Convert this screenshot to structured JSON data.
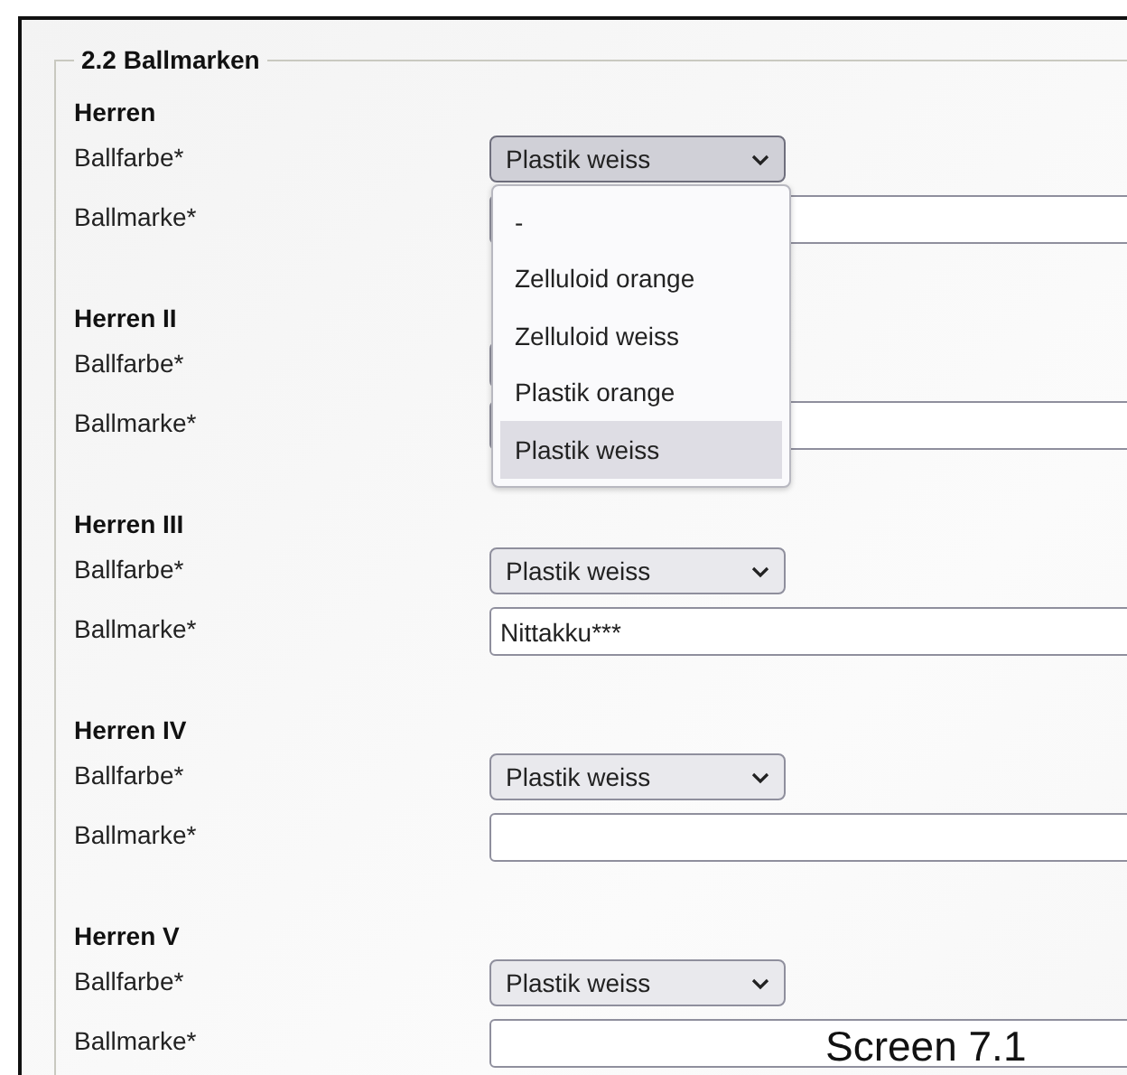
{
  "section": {
    "legend": "2.2 Ballmarken"
  },
  "teams": [
    {
      "name": "Herren",
      "color_label": "Ballfarbe*",
      "color_value": "Plastik weiss",
      "brand_label": "Ballmarke*",
      "expanded": true,
      "options": [
        {
          "label": "-",
          "selected": false
        },
        {
          "label": "Zelluloid orange",
          "selected": false
        },
        {
          "label": "Zelluloid weiss",
          "selected": false
        },
        {
          "label": "Plastik orange",
          "selected": false
        },
        {
          "label": "Plastik weiss",
          "selected": true
        }
      ]
    },
    {
      "name": "Herren II",
      "color_label": "Ballfarbe*",
      "brand_label": "Ballmarke*",
      "expanded": false
    },
    {
      "name": "Herren III",
      "color_label": "Ballfarbe*",
      "color_value": "Plastik weiss",
      "brand_label": "Ballmarke*",
      "brand_value": "Nittakku***",
      "expanded": false
    },
    {
      "name": "Herren IV",
      "color_label": "Ballfarbe*",
      "color_value": "Plastik weiss",
      "brand_label": "Ballmarke*",
      "expanded": false
    },
    {
      "name": "Herren V",
      "color_label": "Ballfarbe*",
      "color_value": "Plastik weiss",
      "brand_label": "Ballmarke*",
      "expanded": false
    }
  ],
  "caption": "Screen 7.1"
}
